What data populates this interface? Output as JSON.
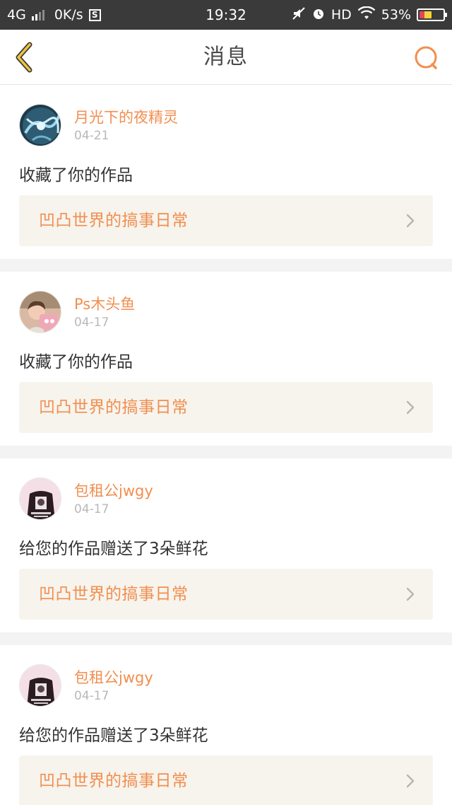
{
  "status_bar": {
    "network": "4G",
    "speed": "0K/s",
    "time": "19:32",
    "hd": "HD",
    "battery": "53%",
    "battery_level": 0.53
  },
  "nav": {
    "title": "消息"
  },
  "colors": {
    "accent": "#f28e4f",
    "back_arrow": "#f3c43a",
    "link_bg": "#f6f4ed"
  },
  "messages": [
    {
      "user": "月光下的夜精灵",
      "date": "04-21",
      "action": "收藏了你的作品",
      "work": "凹凸世界的搞事日常",
      "avatar_icon": "fantasy-art-avatar"
    },
    {
      "user": "Ps木头鱼",
      "date": "04-17",
      "action": "收藏了你的作品",
      "work": "凹凸世界的搞事日常",
      "avatar_icon": "child-photo-avatar"
    },
    {
      "user": "包租公jwgy",
      "date": "04-17",
      "action": "给您的作品赠送了3朵鲜花",
      "work": "凹凸世界的搞事日常",
      "avatar_icon": "shirt-photo-avatar"
    },
    {
      "user": "包租公jwgy",
      "date": "04-17",
      "action": "给您的作品赠送了3朵鲜花",
      "work": "凹凸世界的搞事日常",
      "avatar_icon": "shirt-photo-avatar"
    }
  ]
}
